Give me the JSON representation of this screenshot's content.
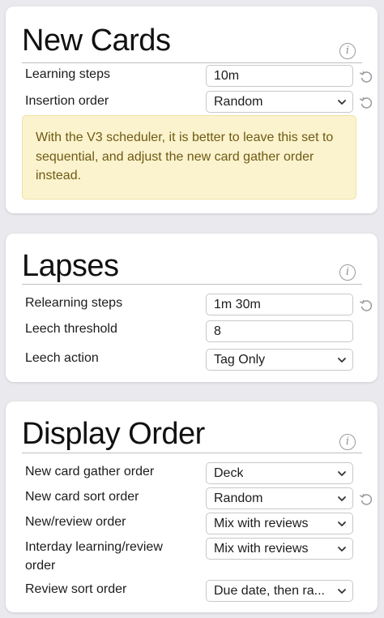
{
  "new_cards": {
    "title": "New Cards",
    "learning_steps": {
      "label": "Learning steps",
      "value": "10m"
    },
    "insertion_order": {
      "label": "Insertion order",
      "value": "Random"
    },
    "warning": "With the V3 scheduler, it is better to leave this set to sequential, and adjust the new card gather order instead."
  },
  "lapses": {
    "title": "Lapses",
    "relearning_steps": {
      "label": "Relearning steps",
      "value": "1m 30m"
    },
    "leech_threshold": {
      "label": "Leech threshold",
      "value": "8"
    },
    "leech_action": {
      "label": "Leech action",
      "value": "Tag Only"
    }
  },
  "display_order": {
    "title": "Display Order",
    "gather_order": {
      "label": "New card gather order",
      "value": "Deck"
    },
    "sort_order": {
      "label": "New card sort order",
      "value": "Random"
    },
    "new_review_order": {
      "label": "New/review order",
      "value": "Mix with reviews"
    },
    "interday_order": {
      "label_line1": "Interday learning/review",
      "label_line2": "order",
      "value": "Mix with reviews"
    },
    "review_sort_order": {
      "label": "Review sort order",
      "value": "Due date, then ra..."
    }
  },
  "icons": {
    "info": "info-icon",
    "revert": "revert-icon",
    "chevron": "chevron-down-icon",
    "info_glyph": "i"
  },
  "colors": {
    "warning_bg": "#fbf3cd",
    "warning_text": "#6f5a16",
    "page_bg": "#e9e9ee"
  }
}
